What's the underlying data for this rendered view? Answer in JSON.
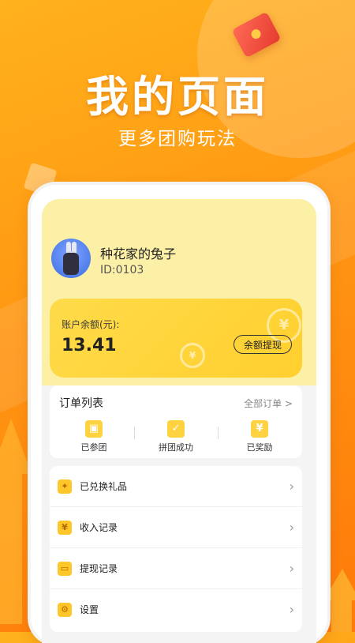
{
  "hero": {
    "title": "我的页面",
    "subtitle": "更多团购玩法"
  },
  "profile": {
    "name": "种花家的兔子",
    "id_text": "ID:0103"
  },
  "balance": {
    "label": "账户余额(元):",
    "value": "13.41",
    "withdraw_label": "余额提现"
  },
  "orders": {
    "title": "订单列表",
    "all_link": "全部订单 >",
    "items": [
      {
        "label": "已参团",
        "icon": "package-icon"
      },
      {
        "label": "拼团成功",
        "icon": "check-box-icon"
      },
      {
        "label": "已奖励",
        "icon": "yen-box-icon"
      }
    ]
  },
  "menu": {
    "items": [
      {
        "label": "已兑换礼品",
        "icon": "gift-icon"
      },
      {
        "label": "收入记录",
        "icon": "yen-coin-icon"
      },
      {
        "label": "提现记录",
        "icon": "wallet-icon"
      },
      {
        "label": "设置",
        "icon": "gear-icon"
      }
    ]
  }
}
